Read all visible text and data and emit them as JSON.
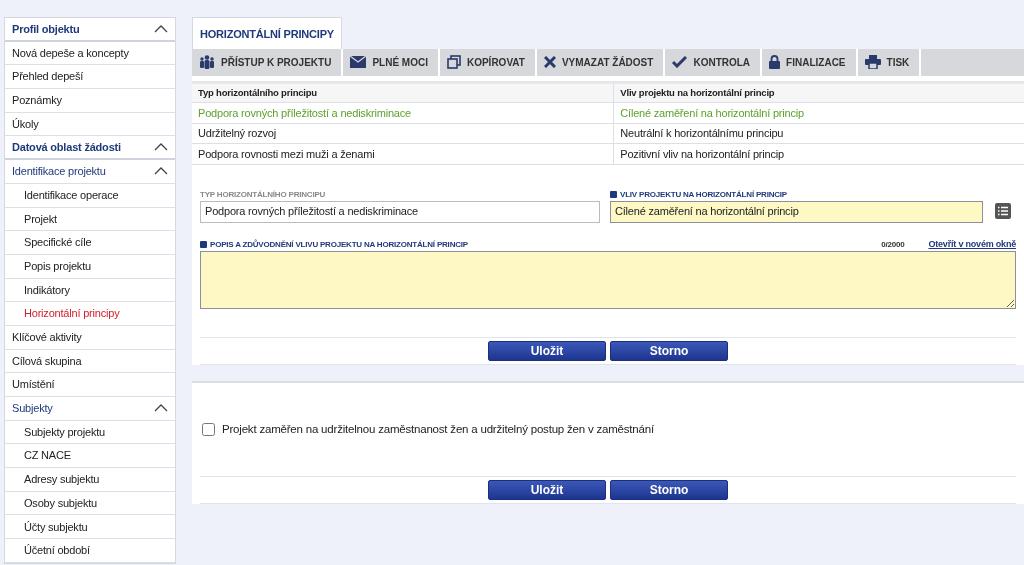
{
  "sidebar": {
    "items": [
      {
        "label": "Profil objektu",
        "kind": "section",
        "expanded": true,
        "selected": false,
        "children": [
          {
            "label": "Nová depeše a koncepty",
            "kind": "link",
            "selected": false
          },
          {
            "label": "Přehled depeší",
            "kind": "link",
            "selected": false
          },
          {
            "label": "Poznámky",
            "kind": "link",
            "selected": false
          },
          {
            "label": "Úkoly",
            "kind": "link",
            "selected": false
          }
        ]
      },
      {
        "label": "Datová oblast žádosti",
        "kind": "section",
        "expanded": true,
        "selected": false,
        "children": [
          {
            "label": "Identifikace projektu",
            "kind": "group",
            "expanded": true,
            "selected": false,
            "children": [
              {
                "label": "Identifikace operace",
                "kind": "link",
                "selected": false
              },
              {
                "label": "Projekt",
                "kind": "link",
                "selected": false
              },
              {
                "label": "Specifické cíle",
                "kind": "link",
                "selected": false
              },
              {
                "label": "Popis projektu",
                "kind": "link",
                "selected": false
              },
              {
                "label": "Indikátory",
                "kind": "link",
                "selected": false
              },
              {
                "label": "Horizontální principy",
                "kind": "link",
                "selected": true
              }
            ]
          },
          {
            "label": "Klíčové aktivity",
            "kind": "link",
            "selected": false
          },
          {
            "label": "Cílová skupina",
            "kind": "link",
            "selected": false
          },
          {
            "label": "Umístění",
            "kind": "link",
            "selected": false
          },
          {
            "label": "Subjekty",
            "kind": "group",
            "expanded": true,
            "selected": false,
            "children": [
              {
                "label": "Subjekty projektu",
                "kind": "link",
                "selected": false
              },
              {
                "label": "CZ NACE",
                "kind": "link",
                "selected": false
              },
              {
                "label": "Adresy subjektu",
                "kind": "link",
                "selected": false
              },
              {
                "label": "Osoby subjektu",
                "kind": "link",
                "selected": false
              },
              {
                "label": "Účty subjektu",
                "kind": "link",
                "selected": false
              },
              {
                "label": "Účetní období",
                "kind": "link",
                "selected": false
              }
            ]
          }
        ]
      }
    ]
  },
  "tabs": [
    {
      "label": "HORIZONTÁLNÍ PRINCIPY",
      "selected": true
    }
  ],
  "toolbar": [
    {
      "label": "PŘÍSTUP K PROJEKTU",
      "kind": "people"
    },
    {
      "label": "PLNÉ MOCI",
      "kind": "envelope"
    },
    {
      "label": "KOPÍROVAT",
      "kind": "copy"
    },
    {
      "label": "VYMAZAT ŽÁDOST",
      "kind": "delete"
    },
    {
      "label": "KONTROLA",
      "kind": "check"
    },
    {
      "label": "FINALIZACE",
      "kind": "lock"
    },
    {
      "label": "TISK",
      "kind": "print"
    }
  ],
  "table": {
    "columns": [
      "Typ horizontálního principu",
      "Vliv projektu na horizontální princip"
    ],
    "rows": [
      {
        "cells": [
          "Podpora rovných příležitostí a nediskriminace",
          "Cílené zaměření na horizontální princip"
        ],
        "selected": true
      },
      {
        "cells": [
          "Udržitelný rozvoj",
          "Neutrální k horizontálnímu principu"
        ],
        "selected": false
      },
      {
        "cells": [
          "Podpora rovnosti mezi muži a ženami",
          "Pozitivní vliv na horizontální princip"
        ],
        "selected": false
      }
    ]
  },
  "form": {
    "type_field": {
      "label": "TYP HORIZONTÁLNÍHO PRINCIPU",
      "value": "Podpora rovných příležitostí a nediskriminace",
      "required": false
    },
    "impact_field": {
      "label": "VLIV PROJEKTU NA HORIZONTÁLNÍ PRINCIP",
      "value": "Cílené zaměření na horizontální princip",
      "required": true
    },
    "description_field": {
      "label": "POPIS A ZDŮVODNĚNÍ VLIVU PROJEKTU NA HORIZONTÁLNÍ PRINCIP",
      "required": true,
      "counter": "0/2000",
      "link": "Otevřít v novém okně"
    },
    "buttons": [
      "Uložit",
      "Storno"
    ]
  },
  "checkbox_section": {
    "checkbox": {
      "label": "Projekt zaměřen na udržitelnou zaměstnanost žen a udržitelný postup žen v zaměstnání",
      "checked": false
    },
    "buttons": [
      "Uložit",
      "Storno"
    ]
  }
}
